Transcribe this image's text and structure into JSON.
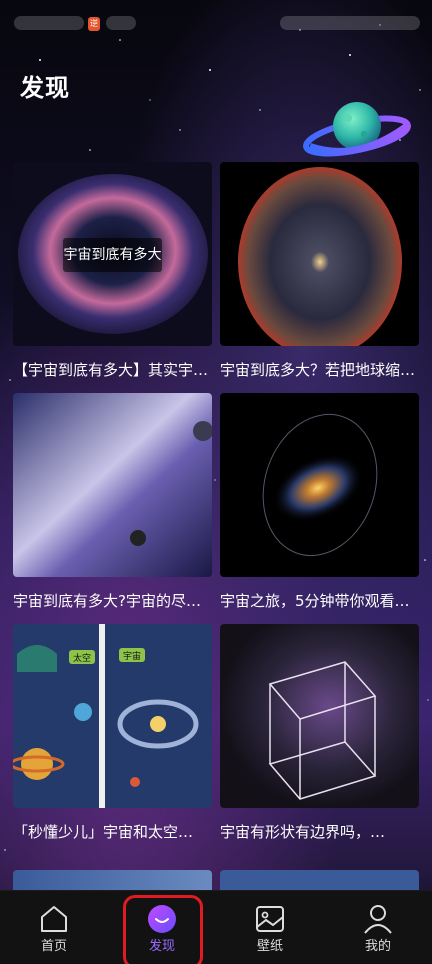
{
  "status_bar": {
    "badge": "逆"
  },
  "page": {
    "title": "发现"
  },
  "cards": [
    {
      "title": "【宇宙到底有多大】其实宇宙只有…",
      "overlay": "宇宙到底有多大",
      "thumb": "galaxy-ring-icon"
    },
    {
      "title": "宇宙到底多大？若把地球缩小…",
      "thumb": "observable-universe-icon"
    },
    {
      "title": "宇宙到底有多大?宇宙的尽头…",
      "thumb": "nebula-planet-icon"
    },
    {
      "title": "宇宙之旅，5分钟带你观看…",
      "thumb": "spiral-galaxy-icon"
    },
    {
      "title": "「秒懂少儿」宇宙和太空…",
      "badge1": "太空",
      "badge2": "宇宙",
      "thumb": "cartoon-space-icon"
    },
    {
      "title": "宇宙有形状有边界吗，…",
      "thumb": "wireframe-cube-icon"
    }
  ],
  "tabs": [
    {
      "label": "首页",
      "icon": "home-icon"
    },
    {
      "label": "发现",
      "icon": "discover-smile-icon",
      "active": true
    },
    {
      "label": "壁纸",
      "icon": "wallpaper-image-icon"
    },
    {
      "label": "我的",
      "icon": "profile-person-icon"
    }
  ],
  "colors": {
    "accent": "#9a6bff",
    "highlight": "#e11b22",
    "tabbar": "#121212"
  }
}
